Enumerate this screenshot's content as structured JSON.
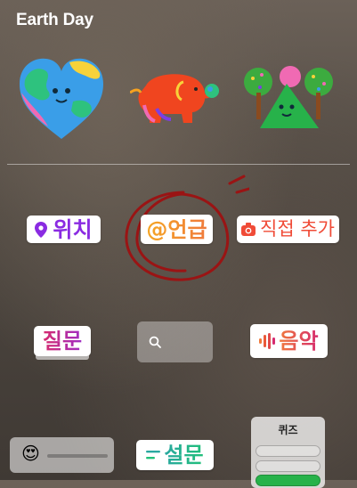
{
  "header": {
    "title": "Earth Day"
  },
  "stickers": {
    "location": {
      "label": "위치",
      "color": "#8a2be2"
    },
    "mention": {
      "label": "@언급"
    },
    "add_photo": {
      "label": "직접 추가",
      "color": "#f04b37"
    },
    "question": {
      "label": "질문"
    },
    "music": {
      "label": "음악"
    },
    "poll": {
      "label": "설문"
    },
    "quiz": {
      "label": "퀴즈"
    },
    "emoji_slider": {
      "emoji": "😍"
    }
  },
  "icons": {
    "location": "location-pin-icon",
    "add_photo": "camera-icon",
    "search": "search-icon",
    "music": "equalizer-icon",
    "poll": "poll-lines-icon"
  }
}
